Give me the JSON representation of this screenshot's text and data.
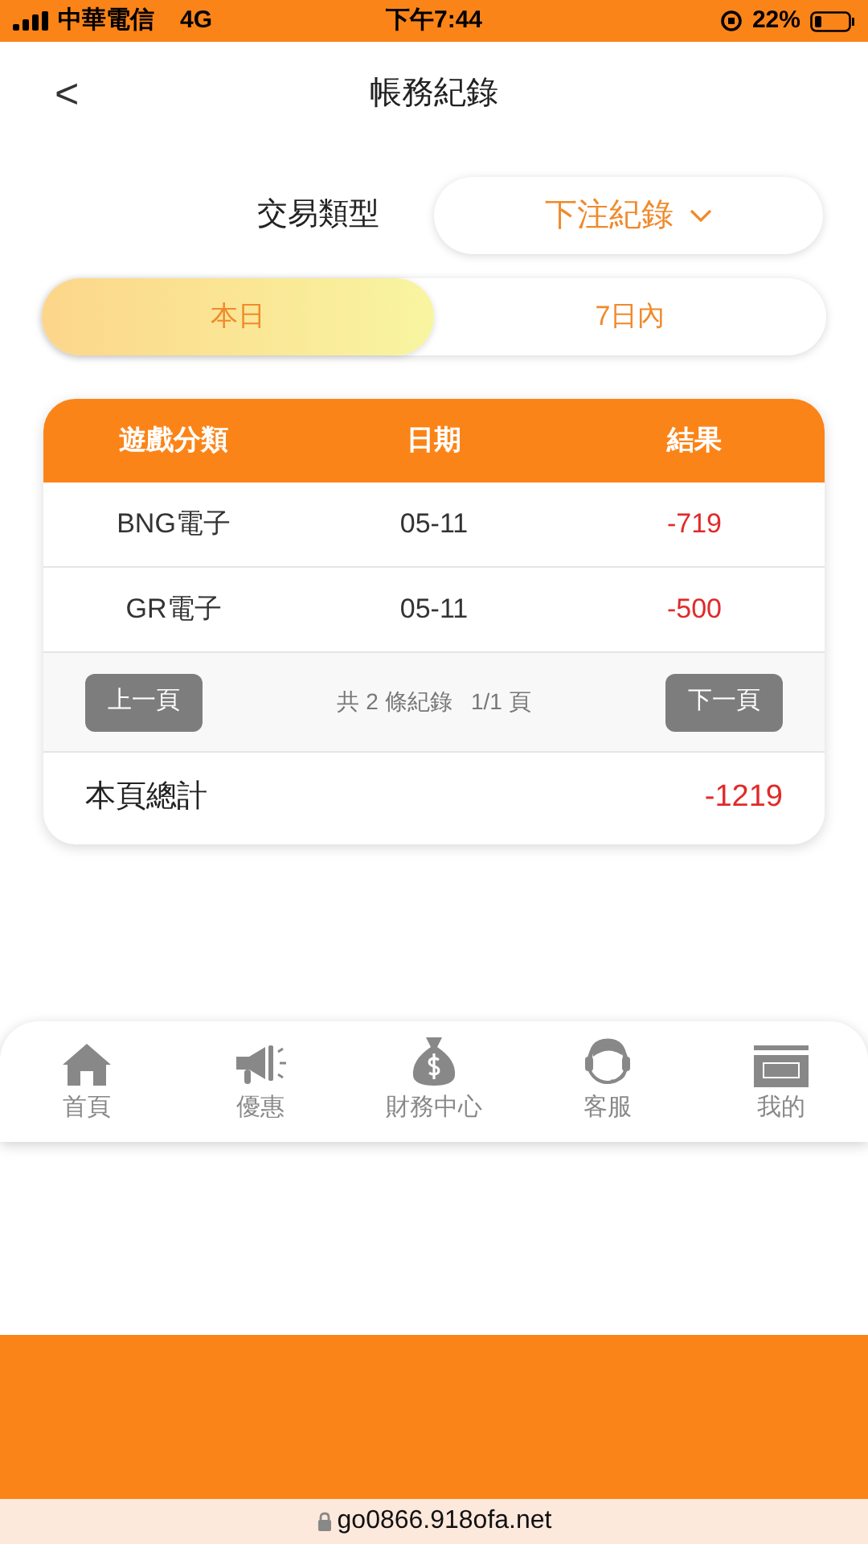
{
  "status_bar": {
    "carrier": "中華電信",
    "network": "4G",
    "time": "下午7:44",
    "battery": "22%"
  },
  "header": {
    "back": "<",
    "title": "帳務紀錄"
  },
  "filter": {
    "label": "交易類型",
    "value": "下注紀錄"
  },
  "periods": [
    {
      "label": "本日",
      "selected": true
    },
    {
      "label": "7日內",
      "selected": false
    }
  ],
  "table": {
    "columns": [
      "遊戲分類",
      "日期",
      "結果"
    ],
    "rows": [
      [
        "BNG電子",
        "05-11",
        "-719"
      ],
      [
        "GR電子",
        "05-11",
        "-500"
      ]
    ]
  },
  "pager": {
    "prev": "上一頁",
    "info": "共 2 條紀錄   1/1 頁",
    "next": "下一頁"
  },
  "total": {
    "label": "本頁總計",
    "value": "-1219"
  },
  "tab_bar": [
    {
      "kind": "home",
      "label": "首頁"
    },
    {
      "kind": "promo",
      "label": "優惠"
    },
    {
      "kind": "money",
      "label": "財務中心"
    },
    {
      "kind": "support",
      "label": "客服"
    },
    {
      "kind": "vip",
      "label": "我的"
    }
  ],
  "browser": {
    "url": "go0866.918ofa.net"
  }
}
